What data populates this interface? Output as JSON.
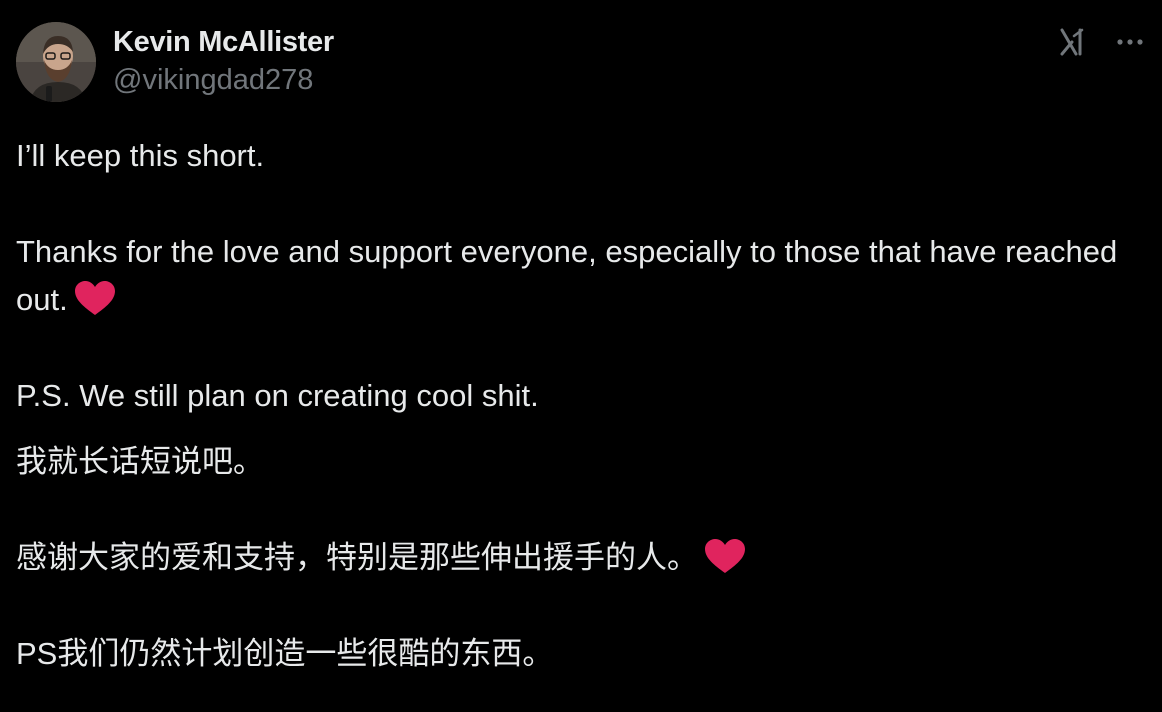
{
  "author": {
    "display_name": "Kevin McAllister",
    "handle": "@vikingdad278"
  },
  "icons": {
    "avatar": "profile-photo",
    "grok": "grok-icon",
    "more": "more-icon",
    "heart": "red-heart-emoji"
  },
  "colors": {
    "background": "#000000",
    "text": "#e7e9ea",
    "secondary_text": "#71767b",
    "heart": "#e0245e"
  },
  "tweet": {
    "line1": "I’ll keep this short.",
    "line2": "Thanks for the love and support everyone, especially to those that have reached out.",
    "line3": "P.S. We still plan on creating cool shit.",
    "translation_line1": "我就长话短说吧。",
    "translation_line2": "感谢大家的爱和支持，特别是那些伸出援手的人。",
    "translation_line3": "PS我们仍然计划创造一些很酷的东西。"
  }
}
